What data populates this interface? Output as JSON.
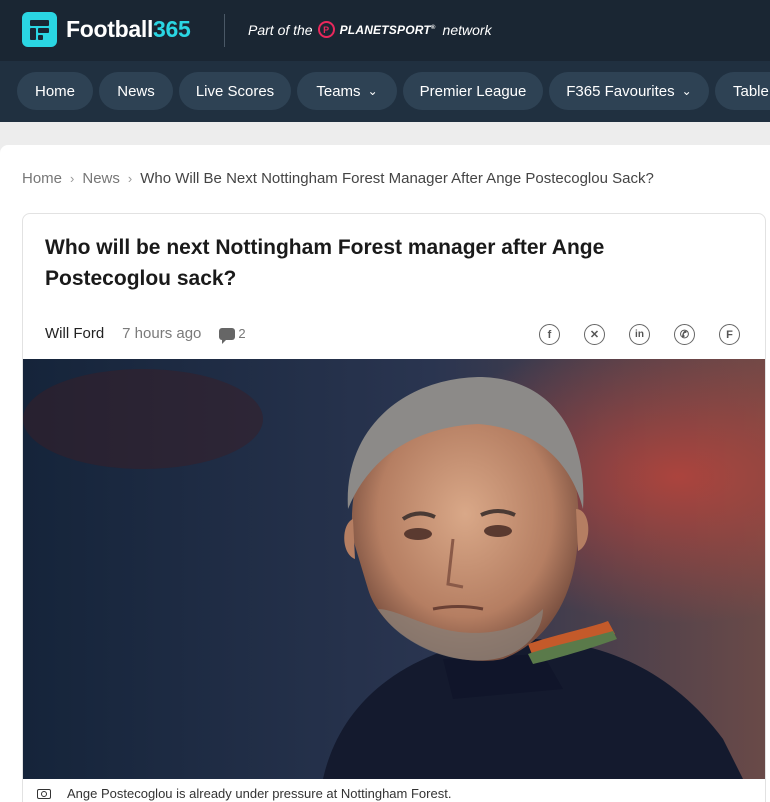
{
  "brand": {
    "name_main": "Football",
    "name_accent": "365"
  },
  "network": {
    "prefix": "Part of the",
    "badge_letter": "P",
    "name": "PLANETSPORT",
    "mark": "®",
    "suffix": "network"
  },
  "nav": {
    "items": [
      {
        "label": "Home"
      },
      {
        "label": "News"
      },
      {
        "label": "Live Scores"
      },
      {
        "label": "Teams",
        "chevron": "⌄"
      },
      {
        "label": "Premier League"
      },
      {
        "label": "F365 Favourites",
        "chevron": "⌄"
      },
      {
        "label": "Table"
      }
    ]
  },
  "breadcrumb": {
    "items": [
      "Home",
      "News"
    ],
    "separator": "›",
    "current": "Who Will Be Next Nottingham Forest Manager After Ange Postecoglou Sack?"
  },
  "article": {
    "title": "Who will be next Nottingham Forest manager after Ange Postecoglou sack?",
    "author": "Will Ford",
    "time": "7 hours ago",
    "comment_count": "2",
    "share": [
      {
        "icon": "facebook-icon",
        "glyph": "f"
      },
      {
        "icon": "x-icon",
        "glyph": "✕"
      },
      {
        "icon": "linkedin-icon",
        "glyph": "in"
      },
      {
        "icon": "whatsapp-icon",
        "glyph": "✆"
      },
      {
        "icon": "flipboard-icon",
        "glyph": "F"
      }
    ],
    "image_caption": "Ange Postecoglou is already under pressure at Nottingham Forest."
  },
  "colors": {
    "topbar": "#1a2633",
    "navbar": "#203040",
    "pill": "#2e4254",
    "accent": "#2ad6e3",
    "planetsport": "#e9285c"
  }
}
